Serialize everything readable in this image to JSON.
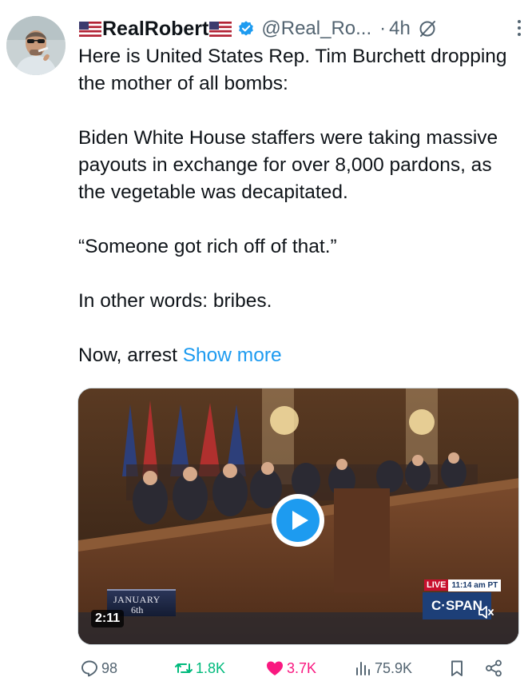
{
  "author": {
    "display_name": "RealRobert",
    "handle": "@Real_Ro...",
    "separator": "·",
    "time": "4h"
  },
  "icons": {
    "flag": "us-flag-icon",
    "verified": "verified-badge-icon",
    "grok": "grok-icon",
    "more": "more-options-icon",
    "reply": "reply-icon",
    "retweet": "retweet-icon",
    "like": "heart-icon",
    "views": "views-icon",
    "bookmark": "bookmark-icon",
    "share": "share-icon",
    "play": "play-icon",
    "mute": "speaker-muted-icon"
  },
  "post": {
    "paragraphs": [
      "Here is United States Rep. Tim Burchett dropping the mother of all bombs:",
      "Biden White House staffers were taking massive payouts in exchange for over 8,000 pardons, as the vegetable was decapitated.",
      "“Someone got rich off of that.”",
      "In other words: bribes."
    ],
    "last_line": "Now, arrest",
    "show_more": "Show more"
  },
  "media": {
    "duration": "2:11",
    "overlay_month": "JANUARY",
    "overlay_day": "6th",
    "live_label": "LIVE",
    "live_time": "11:14 am PT",
    "network": "C·SPAN"
  },
  "metrics": {
    "replies": "98",
    "reposts": "1.8K",
    "likes": "3.7K",
    "views": "75.9K"
  },
  "colors": {
    "text": "#0f1419",
    "secondary": "#536471",
    "link": "#1d9bf0",
    "retweet": "#00ba7c",
    "like": "#f91880",
    "verified": "#1d9bf0"
  }
}
